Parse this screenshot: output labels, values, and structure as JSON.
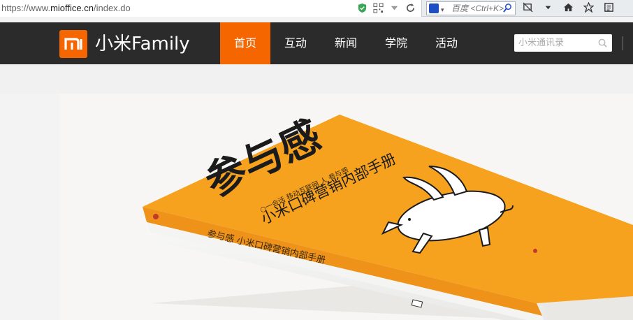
{
  "browser": {
    "url_prefix": "https://www.",
    "url_domain": "mioffice.cn",
    "url_path": "/index.do",
    "search_placeholder": "百度 <Ctrl+K>"
  },
  "header": {
    "logo_text": "mi",
    "brand": "小米Family",
    "nav": [
      {
        "label": "首页",
        "active": true
      },
      {
        "label": "互动"
      },
      {
        "label": "新闻"
      },
      {
        "label": "学院"
      },
      {
        "label": "活动"
      }
    ],
    "search_placeholder": "小米通讯录"
  },
  "hero": {
    "book_title": "参与感",
    "book_subtitle": "小米口碑营销内部手册",
    "book_tagline": "○一会话 移动互联网 人 参与感",
    "spine_text": "参与感 小米口碑营销内部手册",
    "colors": {
      "book": "#f7a21e",
      "accent": "#f56600"
    }
  }
}
